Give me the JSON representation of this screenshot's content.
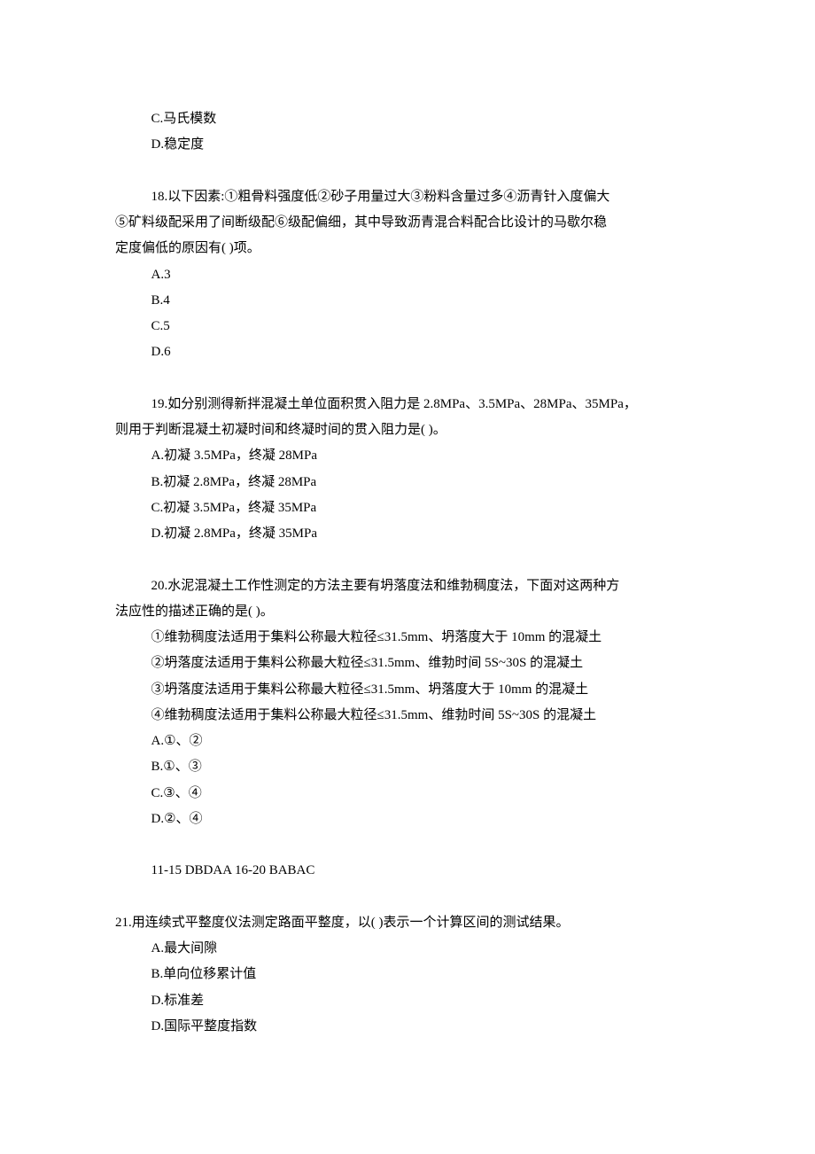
{
  "q17": {
    "optC": "C.马氏模数",
    "optD": "D.稳定度"
  },
  "q18": {
    "line1": "18.以下因素:①粗骨料强度低②砂子用量过大③粉料含量过多④沥青针入度偏大",
    "line2": "⑤矿料级配采用了间断级配⑥级配偏细，其中导致沥青混合料配合比设计的马歇尔稳",
    "line3": "定度偏低的原因有( )项。",
    "optA": "A.3",
    "optB": "B.4",
    "optC": "C.5",
    "optD": "D.6"
  },
  "q19": {
    "line1": "19.如分别测得新拌混凝土单位面积贯入阻力是 2.8MPa、3.5MPa、28MPa、35MPa，",
    "line2": "则用于判断混凝土初凝时间和终凝时间的贯入阻力是( )。",
    "optA": "A.初凝 3.5MPa，终凝 28MPa",
    "optB": "B.初凝 2.8MPa，终凝 28MPa",
    "optC": "C.初凝 3.5MPa，终凝 35MPa",
    "optD": "D.初凝 2.8MPa，终凝 35MPa"
  },
  "q20": {
    "line1": "20.水泥混凝土工作性测定的方法主要有坍落度法和维勃稠度法，下面对这两种方",
    "line2": "法应性的描述正确的是( )。",
    "stmt1": "①维勃稠度法适用于集料公称最大粒径≤31.5mm、坍落度大于 10mm 的混凝土",
    "stmt2": "②坍落度法适用于集料公称最大粒径≤31.5mm、维勃时间 5S~30S 的混凝土",
    "stmt3": "③坍落度法适用于集料公称最大粒径≤31.5mm、坍落度大于 10mm 的混凝土",
    "stmt4": "④维勃稠度法适用于集料公称最大粒径≤31.5mm、维勃时间 5S~30S 的混凝土",
    "optA": "A.①、②",
    "optB": "B.①、③",
    "optC": "C.③、④",
    "optD": "D.②、④"
  },
  "answerKey": "11-15   DBDAA    16-20   BABAC",
  "q21": {
    "head": "21.用连续式平整度仪法测定路面平整度，以( )表示一个计算区间的测试结果。",
    "optA": "A.最大间隙",
    "optB": "B.单向位移累计值",
    "optC": "D.标准差",
    "optD": "D.国际平整度指数"
  }
}
